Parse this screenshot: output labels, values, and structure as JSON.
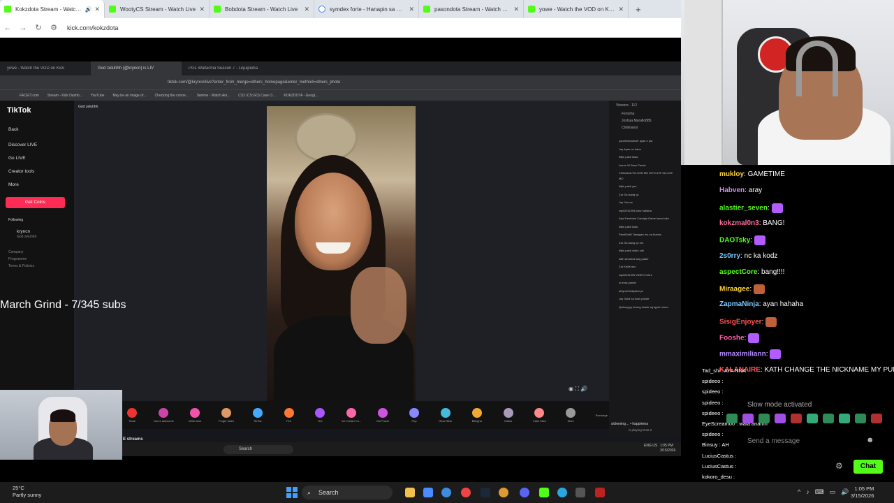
{
  "browser": {
    "tabs": [
      {
        "label": "Kokzdota Stream - Watch L",
        "active": true
      },
      {
        "label": "WootyCS Stream - Watch Live"
      },
      {
        "label": "Bobdota Stream - Watch Live"
      },
      {
        "label": "symdex forte - Hanapin sa Goo"
      },
      {
        "label": "pasondota Stream - Watch Live"
      },
      {
        "label": "yowe - Watch the VOD on Kick"
      }
    ],
    "url": "kick.com/kokzdota"
  },
  "inner_browser": {
    "tabs": [
      "yowe - Watch the VOD on Kick",
      "God zeluhhh (@krync​n) is LIV",
      "PGL Wallachia Season 7 - Liquipedia"
    ],
    "url": "tiktok.com/@kryncn/live?enter_from_merge=others_homepage&enter_method=others_photo",
    "bookmarks": [
      "FACEIT.com",
      "Stream - Kick Dashb...",
      "YouTube",
      "May be an image of...",
      "Checking the conne...",
      "9anime - Watch Ani...",
      "CS2 (CS:GO) Case O...",
      "KOKZDOTA - Googl..."
    ]
  },
  "tiktok": {
    "logo": "TikTok",
    "nav": [
      "Back",
      "Discover LIVE",
      "Go LIVE",
      "Creator tools",
      "More"
    ],
    "coins_button": "Get Coins",
    "following_label": "Following",
    "following_user": "krync​n",
    "following_sub": "God zeluhhh",
    "footer": [
      "Company",
      "Programme",
      "Terms & Policies"
    ],
    "host": "God zeluhhh",
    "viewers_label": "Viewers · 112",
    "viewers": [
      "Ferosha",
      "Joshua Marafio886",
      "Chilimansi"
    ],
    "comments": [
      "youneedcarbuff: ayan n pla",
      "Jay Ayan na haha",
      "bitjin pakir ikaw",
      "Icaron W Boss Pande",
      "Chilimansi PA JOIN MO DITO ATE SA LIVE MO",
      "bitjin pakir yes",
      "Zzz Sa isang cp",
      "Jay Yan na",
      "rap02011994 ikaw hahaha",
      "Aqui Kembem Camigla Game kana kokz",
      "bitjin pakir ikaw",
      "Pandi3ali0 Tawagan mo na thanks",
      "Zzz Sa isang cp mo",
      "bitjin pakir video call",
      "kath sinuntok ang pader",
      "Zzz Kahit ano",
      "rap02011994 VIDEO CALL",
      "w boss pande",
      "dirtyneil bidyakol po",
      "Jay Solid ka boss pande",
      "Qwincyyyy Anong shade ng lippie mooo"
    ],
    "gifts": [
      "Rose",
      "You're awesome",
      "Wink wink",
      "Finger heart",
      "TikTok",
      "Fire",
      "GG",
      "Ice Cream Co...",
      "Girl Power",
      "Pop",
      "Glow Stick",
      "Biinigha",
      "Oldies",
      "Cake Slice",
      "More"
    ],
    "recharge": "Recharge",
    "streams_label": "E streams",
    "rec_title": "sickening… • happiness",
    "rec_sub": "is playing Dota 2"
  },
  "inner_taskbar": {
    "search": "Search",
    "lang": "ENG US",
    "time": "1:05 PM",
    "date": "3/15/2026"
  },
  "overlay": {
    "goal": "March Grind - 7/345 subs"
  },
  "chat": {
    "messages": [
      {
        "user": "mukloy",
        "text": "GAMETIME",
        "color": "#ffd43b"
      },
      {
        "user": "Habven",
        "text": "aray",
        "color": "#c792ea"
      },
      {
        "user": "alastier_seven",
        "text": "",
        "color": "#53fc18"
      },
      {
        "user": "kokzmal0n3",
        "text": "BANG!",
        "color": "#ff6b9d"
      },
      {
        "user": "DAOTsky",
        "text": "",
        "color": "#53fc18"
      },
      {
        "user": "2s0rry",
        "text": "nc ka kodz",
        "color": "#7ec8ff"
      },
      {
        "user": "aspectCore",
        "text": "bang!!!!",
        "color": "#53fc18"
      },
      {
        "user": "Miraagee",
        "text": "",
        "color": "#ffd43b"
      },
      {
        "user": "ZapmaNinja",
        "text": "ayan hahaha",
        "color": "#7ec8ff"
      },
      {
        "user": "SisigEnjoyer",
        "text": "",
        "color": "#ff5555"
      },
      {
        "user": "Fooshe",
        "text": "",
        "color": "#ff5fa8"
      },
      {
        "user": "mmaximiliann",
        "text": "",
        "color": "#b48cff"
      },
      {
        "user": "KALANAIRE",
        "text": "KATH CHANGE THE NICKNAME MY PUKE",
        "color": "#ff5555"
      }
    ],
    "mini": [
      {
        "user": "Tad_shi",
        "text": "AYA NNA"
      },
      {
        "user": "spideeo",
        "text": ""
      },
      {
        "user": "spideeo",
        "text": ""
      },
      {
        "user": "spideeo",
        "text": ""
      },
      {
        "user": "spideeo",
        "text": ""
      },
      {
        "user": "EyeScream00",
        "text": "wala anamn"
      },
      {
        "user": "spideeo",
        "text": ""
      },
      {
        "user": "Binsuy",
        "text": "AH"
      },
      {
        "user": "LuciusCastus",
        "text": ""
      },
      {
        "user": "LuciusCastus",
        "text": ""
      },
      {
        "user": "kokoro_desu",
        "text": ""
      }
    ],
    "mode_notice": "Slow mode activated",
    "placeholder": "Send a message",
    "chat_button": "Chat"
  },
  "taskbar": {
    "weather_temp": "25°C",
    "weather_desc": "Partly sunny",
    "search": "Search",
    "time": "1:05 PM",
    "date": "3/15/2026"
  }
}
